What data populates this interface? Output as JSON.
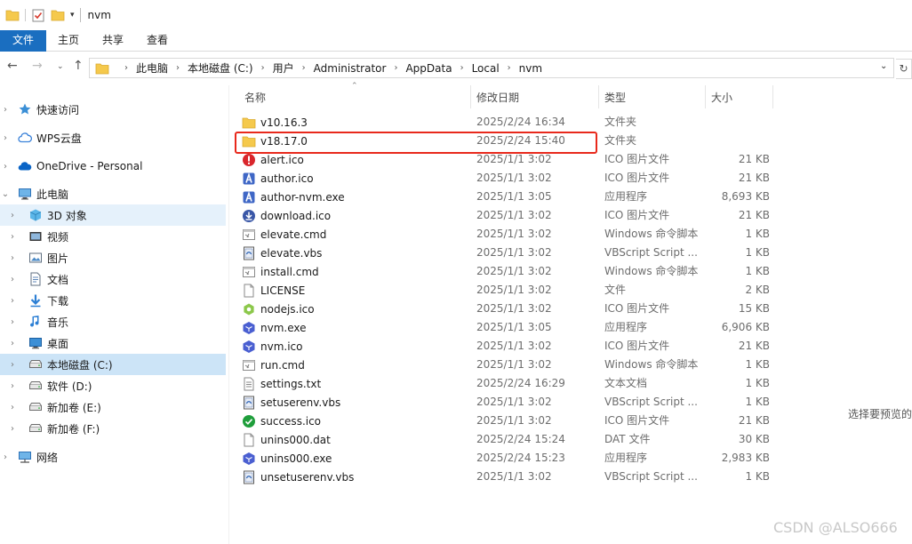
{
  "window": {
    "title": "nvm"
  },
  "ribbon": {
    "tabs": [
      "文件",
      "主页",
      "共享",
      "查看"
    ]
  },
  "address": {
    "crumbs": [
      "此电脑",
      "本地磁盘 (C:)",
      "用户",
      "Administrator",
      "AppData",
      "Local",
      "nvm"
    ]
  },
  "nav": [
    {
      "label": "快速访问",
      "icon": "star-icon",
      "level": 0,
      "chev": "›"
    },
    {
      "label": "WPS云盘",
      "icon": "cloud-icon",
      "level": 0,
      "chev": "›"
    },
    {
      "label": "OneDrive - Personal",
      "icon": "onedrive-icon",
      "level": 0,
      "chev": "›"
    },
    {
      "label": "此电脑",
      "icon": "computer-icon",
      "level": 0,
      "chev": "⌄"
    },
    {
      "label": "3D 对象",
      "icon": "cube-icon",
      "level": 1,
      "chev": "›"
    },
    {
      "label": "视频",
      "icon": "video-icon",
      "level": 1,
      "chev": "›"
    },
    {
      "label": "图片",
      "icon": "picture-icon",
      "level": 1,
      "chev": "›"
    },
    {
      "label": "文档",
      "icon": "document-icon",
      "level": 1,
      "chev": "›"
    },
    {
      "label": "下载",
      "icon": "download-arrow-icon",
      "level": 1,
      "chev": "›"
    },
    {
      "label": "音乐",
      "icon": "music-icon",
      "level": 1,
      "chev": "›"
    },
    {
      "label": "桌面",
      "icon": "desktop-icon",
      "level": 1,
      "chev": "›"
    },
    {
      "label": "本地磁盘 (C:)",
      "icon": "drive-icon",
      "level": 1,
      "chev": "›"
    },
    {
      "label": "软件 (D:)",
      "icon": "drive-icon",
      "level": 1,
      "chev": "›"
    },
    {
      "label": "新加卷 (E:)",
      "icon": "drive-icon",
      "level": 1,
      "chev": "›"
    },
    {
      "label": "新加卷 (F:)",
      "icon": "drive-icon",
      "level": 1,
      "chev": "›"
    },
    {
      "label": "网络",
      "icon": "network-icon",
      "level": 0,
      "chev": "›"
    }
  ],
  "columns": {
    "name": "名称",
    "date": "修改日期",
    "type": "类型",
    "size": "大小"
  },
  "files": [
    {
      "name": "v10.16.3",
      "date": "2025/2/24 16:34",
      "type": "文件夹",
      "size": "",
      "icon": "folder-icon"
    },
    {
      "name": "v18.17.0",
      "date": "2025/2/24 15:40",
      "type": "文件夹",
      "size": "",
      "icon": "folder-icon"
    },
    {
      "name": "alert.ico",
      "date": "2025/1/1 3:02",
      "type": "ICO 图片文件",
      "size": "21 KB",
      "icon": "alert-icon"
    },
    {
      "name": "author.ico",
      "date": "2025/1/1 3:02",
      "type": "ICO 图片文件",
      "size": "21 KB",
      "icon": "author-icon"
    },
    {
      "name": "author-nvm.exe",
      "date": "2025/1/1 3:05",
      "type": "应用程序",
      "size": "8,693 KB",
      "icon": "author-icon"
    },
    {
      "name": "download.ico",
      "date": "2025/1/1 3:02",
      "type": "ICO 图片文件",
      "size": "21 KB",
      "icon": "download-icon"
    },
    {
      "name": "elevate.cmd",
      "date": "2025/1/1 3:02",
      "type": "Windows 命令脚本",
      "size": "1 KB",
      "icon": "script-icon"
    },
    {
      "name": "elevate.vbs",
      "date": "2025/1/1 3:02",
      "type": "VBScript Script ...",
      "size": "1 KB",
      "icon": "vbs-icon"
    },
    {
      "name": "install.cmd",
      "date": "2025/1/1 3:02",
      "type": "Windows 命令脚本",
      "size": "1 KB",
      "icon": "script-icon"
    },
    {
      "name": "LICENSE",
      "date": "2025/1/1 3:02",
      "type": "文件",
      "size": "2 KB",
      "icon": "file-icon"
    },
    {
      "name": "nodejs.ico",
      "date": "2025/1/1 3:02",
      "type": "ICO 图片文件",
      "size": "15 KB",
      "icon": "nodejs-icon"
    },
    {
      "name": "nvm.exe",
      "date": "2025/1/1 3:05",
      "type": "应用程序",
      "size": "6,906 KB",
      "icon": "nvm-icon"
    },
    {
      "name": "nvm.ico",
      "date": "2025/1/1 3:02",
      "type": "ICO 图片文件",
      "size": "21 KB",
      "icon": "nvm-icon"
    },
    {
      "name": "run.cmd",
      "date": "2025/1/1 3:02",
      "type": "Windows 命令脚本",
      "size": "1 KB",
      "icon": "script-icon"
    },
    {
      "name": "settings.txt",
      "date": "2025/2/24 16:29",
      "type": "文本文档",
      "size": "1 KB",
      "icon": "text-file-icon"
    },
    {
      "name": "setuserenv.vbs",
      "date": "2025/1/1 3:02",
      "type": "VBScript Script ...",
      "size": "1 KB",
      "icon": "vbs-icon"
    },
    {
      "name": "success.ico",
      "date": "2025/1/1 3:02",
      "type": "ICO 图片文件",
      "size": "21 KB",
      "icon": "success-icon"
    },
    {
      "name": "unins000.dat",
      "date": "2025/2/24 15:24",
      "type": "DAT 文件",
      "size": "30 KB",
      "icon": "file-icon"
    },
    {
      "name": "unins000.exe",
      "date": "2025/2/24 15:23",
      "type": "应用程序",
      "size": "2,983 KB",
      "icon": "nvm-icon"
    },
    {
      "name": "unsetuserenv.vbs",
      "date": "2025/1/1 3:02",
      "type": "VBScript Script ...",
      "size": "1 KB",
      "icon": "vbs-icon"
    }
  ],
  "preview": {
    "text": "选择要预览的"
  },
  "watermark": {
    "text": "CSDN @ALSO666"
  },
  "colors": {
    "accent": "#1a6ec0",
    "selected": "#cce4f7",
    "highlight_box": "#e8291c",
    "folder": "#f5c94c"
  }
}
